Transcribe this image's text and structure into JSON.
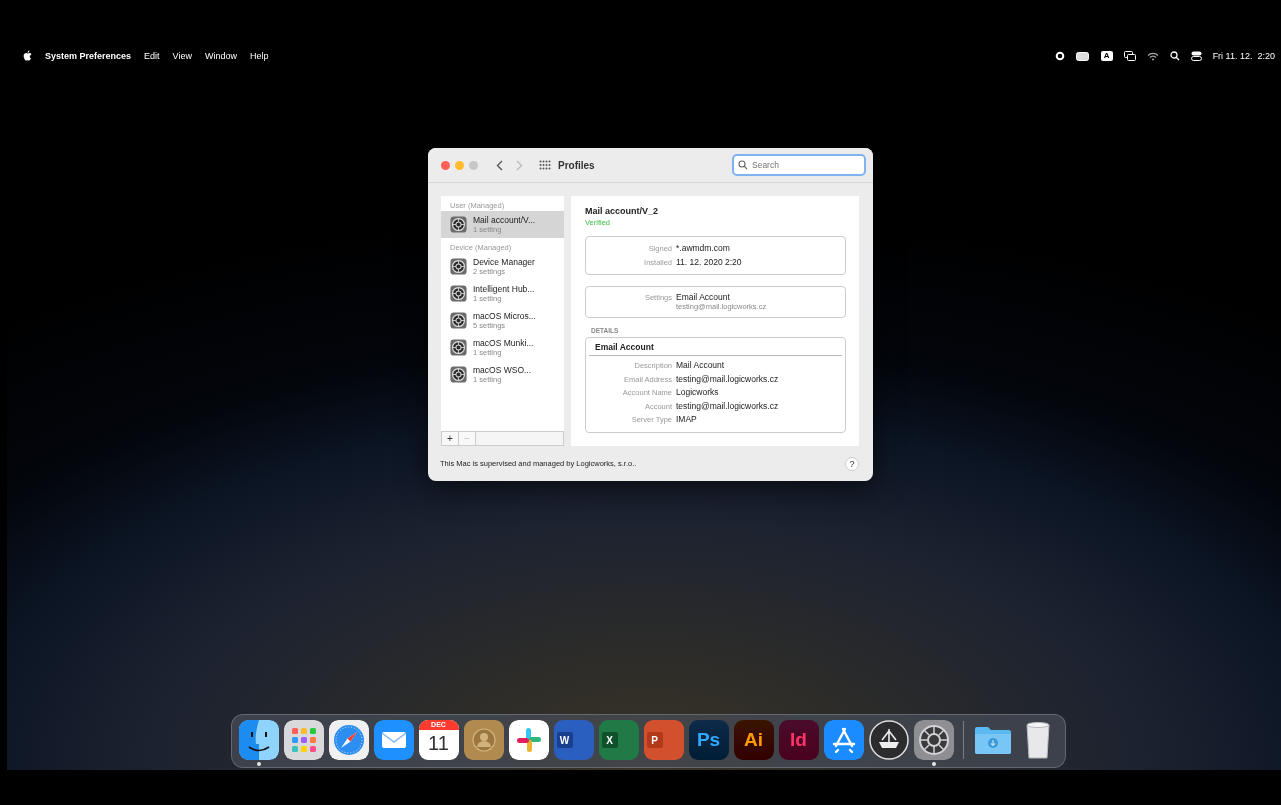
{
  "menu_bar": {
    "app_name": "System Preferences",
    "menus": [
      "Edit",
      "View",
      "Window",
      "Help"
    ],
    "input_source": "A",
    "clock": "Fri 11. 12.  2:20"
  },
  "window": {
    "title": "Profiles",
    "search": {
      "placeholder": "Search"
    },
    "sidebar": {
      "groups": [
        {
          "heading": "User (Managed)",
          "items": [
            {
              "name": "Mail account/V...",
              "subtitle": "1 setting",
              "selected": true
            }
          ]
        },
        {
          "heading": "Device (Managed)",
          "items": [
            {
              "name": "Device Manager",
              "subtitle": "2 settings",
              "selected": false
            },
            {
              "name": "Intelligent Hub...",
              "subtitle": "1 setting",
              "selected": false
            },
            {
              "name": "macOS Micros...",
              "subtitle": "5 settings",
              "selected": false
            },
            {
              "name": "macOS Munki...",
              "subtitle": "1 setting",
              "selected": false
            },
            {
              "name": "macOS WSO...",
              "subtitle": "1 setting",
              "selected": false
            }
          ]
        }
      ],
      "add": "+",
      "remove": "−"
    },
    "detail": {
      "title": "Mail account/V_2",
      "status": "Verified",
      "info": [
        {
          "label": "Signed",
          "value": "*.awmdm.com"
        },
        {
          "label": "Installed",
          "value": "11. 12. 2020 2:20"
        }
      ],
      "settings": {
        "label": "Settings",
        "value": "Email Account",
        "subvalue": "testing@mail.logicworks.cz"
      },
      "details_heading": "DETAILS",
      "details": {
        "title": "Email Account",
        "rows": [
          {
            "label": "Description",
            "value": "Mail Account"
          },
          {
            "label": "Email Address",
            "value": "testing@mail.logicworks.cz"
          },
          {
            "label": "Account Name",
            "value": "Logicworks"
          },
          {
            "label": "Account",
            "value": "testing@mail.logicworks.cz"
          },
          {
            "label": "Server Type",
            "value": "IMAP"
          }
        ]
      }
    },
    "footer": "This Mac is supervised and managed by Logicworks, s.r.o..",
    "help": "?"
  },
  "dock": [
    {
      "kind": "finder",
      "running": true
    },
    {
      "kind": "launchpad",
      "running": false
    },
    {
      "kind": "safari",
      "running": false
    },
    {
      "kind": "mail",
      "running": false
    },
    {
      "kind": "calendar",
      "label": "DEC",
      "sublabel": "11",
      "running": false
    },
    {
      "kind": "contacts",
      "running": false
    },
    {
      "kind": "slack",
      "running": false
    },
    {
      "kind": "word",
      "label": "W",
      "running": false
    },
    {
      "kind": "excel",
      "label": "X",
      "running": false
    },
    {
      "kind": "powerpoint",
      "label": "P",
      "running": false
    },
    {
      "kind": "photoshop",
      "label": "Ps",
      "running": false
    },
    {
      "kind": "illustrator",
      "label": "Ai",
      "running": false
    },
    {
      "kind": "indesign",
      "label": "Id",
      "running": false
    },
    {
      "kind": "appstore",
      "running": false
    },
    {
      "kind": "utility",
      "running": false
    },
    {
      "kind": "settings",
      "running": true
    },
    {
      "kind": "separator"
    },
    {
      "kind": "folder",
      "running": false
    },
    {
      "kind": "trash",
      "running": false
    }
  ]
}
